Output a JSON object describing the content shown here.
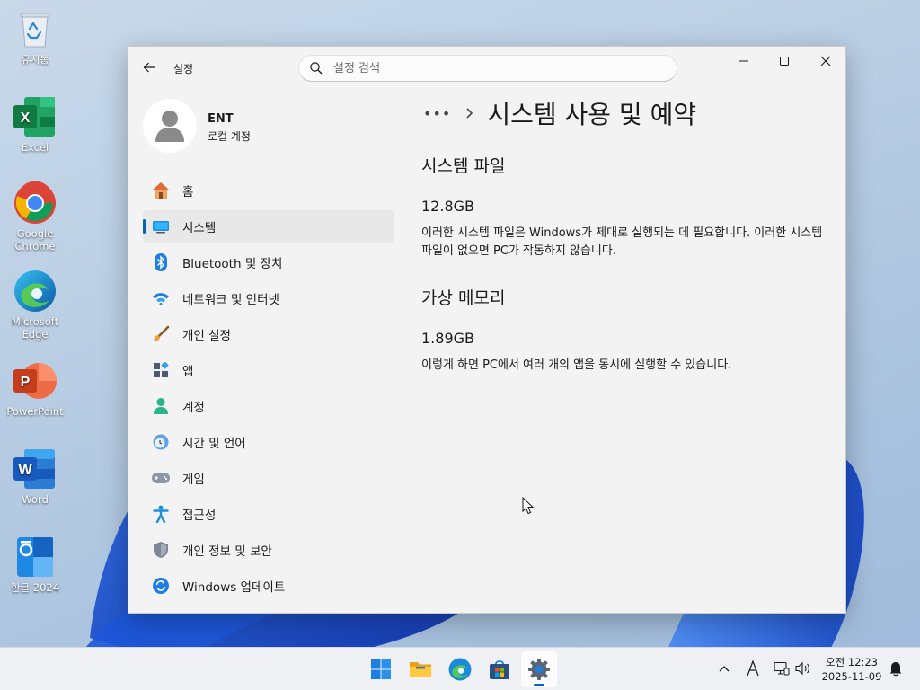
{
  "desktop": {
    "icons": [
      {
        "label": "휴지통",
        "icon": "recycle-bin-icon"
      },
      {
        "label": "Excel",
        "icon": "excel-icon"
      },
      {
        "label": "Google Chrome",
        "icon": "chrome-icon"
      },
      {
        "label": "Microsoft Edge",
        "icon": "edge-icon"
      },
      {
        "label": "PowerPoint",
        "icon": "powerpoint-icon"
      },
      {
        "label": "Word",
        "icon": "word-icon"
      },
      {
        "label": "한글 2024",
        "icon": "hangul-icon"
      }
    ]
  },
  "window": {
    "app_title": "설정",
    "search": {
      "placeholder": "설정 검색",
      "value": ""
    }
  },
  "sidebar": {
    "profile": {
      "name": "ENT",
      "subtitle": "로컬 계정"
    },
    "items": [
      {
        "label": "홈",
        "icon": "home-icon",
        "active": false
      },
      {
        "label": "시스템",
        "icon": "system-icon",
        "active": true
      },
      {
        "label": "Bluetooth 및 장치",
        "icon": "bluetooth-icon",
        "active": false
      },
      {
        "label": "네트워크 및 인터넷",
        "icon": "wifi-icon",
        "active": false
      },
      {
        "label": "개인 설정",
        "icon": "brush-icon",
        "active": false
      },
      {
        "label": "앱",
        "icon": "apps-icon",
        "active": false
      },
      {
        "label": "계정",
        "icon": "account-icon",
        "active": false
      },
      {
        "label": "시간 및 언어",
        "icon": "time-language-icon",
        "active": false
      },
      {
        "label": "게임",
        "icon": "gamepad-icon",
        "active": false
      },
      {
        "label": "접근성",
        "icon": "accessibility-icon",
        "active": false
      },
      {
        "label": "개인 정보 및 보안",
        "icon": "shield-icon",
        "active": false
      },
      {
        "label": "Windows 업데이트",
        "icon": "update-icon",
        "active": false
      }
    ]
  },
  "content": {
    "breadcrumb_more": "•••",
    "page_title": "시스템 사용 및 예약",
    "sections": [
      {
        "title": "시스템 파일",
        "size": "12.8GB",
        "description": "이러한 시스템 파일은 Windows가 제대로 실행되는 데 필요합니다. 이러한 시스템 파일이 없으면 PC가 작동하지 않습니다."
      },
      {
        "title": "가상 메모리",
        "size": "1.89GB",
        "description": "이렇게 하면 PC에서 여러 개의 앱을 동시에 실행할 수 있습니다."
      }
    ]
  },
  "taskbar": {
    "apps": [
      "start-icon",
      "file-explorer-icon",
      "edge-icon",
      "store-icon",
      "settings-icon"
    ],
    "active_app": "settings-icon",
    "clock": {
      "ampm": "오전",
      "time": "12:23",
      "date": "2025-11-09"
    }
  },
  "colors": {
    "accent": "#0067c0",
    "window_bg": "#f3f3f3",
    "active_nav_bg": "#e8e8e8"
  }
}
